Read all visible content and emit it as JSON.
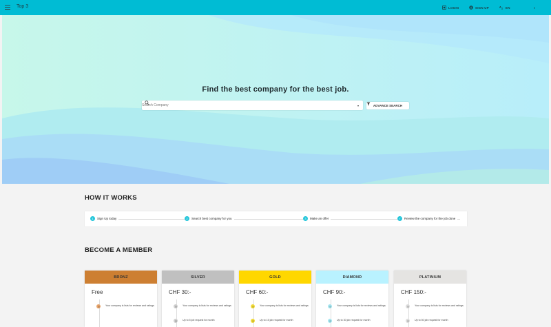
{
  "app": {
    "title": "Top 3"
  },
  "topbar": {
    "login_label": "LOGIN",
    "signup_label": "SIGN UP",
    "language_label": "EN"
  },
  "hero": {
    "title": "Find the best company for the best job.",
    "search_placeholder": "Search Company",
    "advance_search_label": "ADVANCE SEARCH"
  },
  "how_it_works": {
    "title": "HOW IT WORKS",
    "steps": [
      {
        "label": "Sign Up today"
      },
      {
        "label": "Search best company for you"
      },
      {
        "label": "Make an offer"
      },
      {
        "label": "Review the company for the job done"
      }
    ]
  },
  "membership": {
    "title": "BECOME A MEMBER",
    "plans": [
      {
        "name": "BRONZ",
        "price": "Free",
        "color": "#cd7f32",
        "dot": "#e6a36a",
        "features": [
          "Your company is lists for reviews and ratings",
          ""
        ]
      },
      {
        "name": "SILVER",
        "price": "CHF 30:-",
        "color": "#c0c0c0",
        "dot": "#cfcfcf",
        "features": [
          "Your company is lists for reviews and ratings",
          "Up to 5 job request for month"
        ]
      },
      {
        "name": "GOLD",
        "price": "CHF 60:-",
        "color": "#ffd700",
        "dot": "#f2db3a",
        "features": [
          "Your company is lists for reviews and ratings",
          "Up to 15 job request for month"
        ]
      },
      {
        "name": "DIAMOND",
        "price": "CHF 90:-",
        "color": "#b9f2ff",
        "dot": "#a6e6f0",
        "features": [
          "Your company is lists for reviews and ratings",
          "Up to 30 job request for month"
        ]
      },
      {
        "name": "PLATINIUM",
        "price": "CHF 150:-",
        "color": "#e5e4e2",
        "dot": "#dcdcdc",
        "features": [
          "Your company is lists for reviews and ratings",
          "Up to 50 job request for month"
        ]
      }
    ]
  },
  "colors": {
    "topbar": "#00bcd4",
    "step_accent": "#26c6da"
  }
}
